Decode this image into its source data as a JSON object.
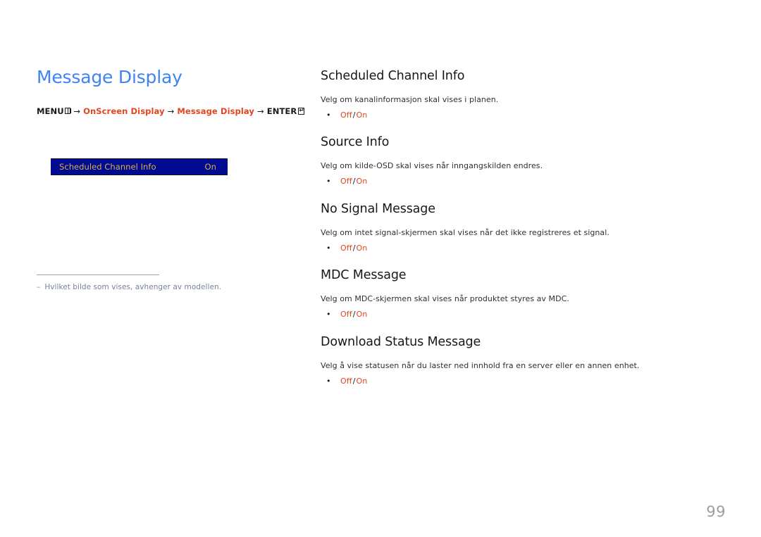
{
  "page": {
    "title": "Message Display",
    "number": "99"
  },
  "breadcrumb": {
    "menu_label": "MENU",
    "menu_icon": "menu-keypad-icon",
    "arrow": "→",
    "step1": "OnScreen Display",
    "step2": "Message Display",
    "enter_label": "ENTER",
    "enter_icon": "enter-return-icon",
    "enter_glyph": "↵"
  },
  "osd_preview": {
    "name": "osd-menu-bar",
    "label": "Scheduled Channel Info",
    "value": "On",
    "bg_color": "#000b91",
    "text_color": "#d8b042"
  },
  "footnote": {
    "dash": "–",
    "text": "Hvilket bilde som vises, avhenger av modellen."
  },
  "sections": [
    {
      "title": "Scheduled Channel Info",
      "description": "Velg om kanalinformasjon skal vises i planen.",
      "bullet": "•",
      "option_off": "Off",
      "option_sep": "/",
      "option_on": "On"
    },
    {
      "title": "Source Info",
      "description": "Velg om kilde-OSD skal vises når inngangskilden endres.",
      "bullet": "•",
      "option_off": "Off",
      "option_sep": "/",
      "option_on": "On"
    },
    {
      "title": "No Signal Message",
      "description": "Velg om intet signal-skjermen skal vises når det ikke registreres et signal.",
      "bullet": "•",
      "option_off": "Off",
      "option_sep": "/",
      "option_on": "On"
    },
    {
      "title": "MDC Message",
      "description": "Velg om MDC-skjermen skal vises når produktet styres av MDC.",
      "bullet": "•",
      "option_off": "Off",
      "option_sep": "/",
      "option_on": "On"
    },
    {
      "title": "Download Status Message",
      "description": "Velg å vise statusen når du laster ned innhold fra en server eller en annen enhet.",
      "bullet": "•",
      "option_off": "Off",
      "option_sep": "/",
      "option_on": "On"
    }
  ],
  "colors": {
    "title_blue": "#3f83f5",
    "accent_orange": "#e2451f",
    "osd_navy": "#000b91",
    "osd_gold": "#d8b042",
    "footnote_gray": "#78819a",
    "page_number_gray": "#9e9e9e"
  }
}
